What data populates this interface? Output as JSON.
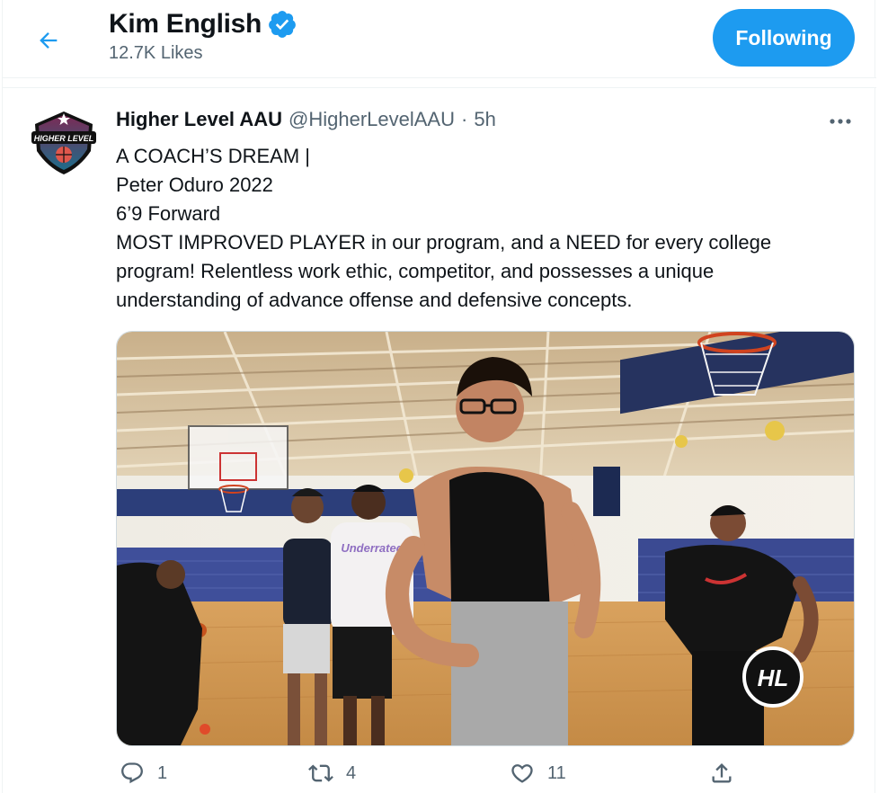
{
  "header": {
    "title": "Kim English",
    "subtitle": "12.7K Likes",
    "follow_label": "Following",
    "back_icon": "arrow-left-icon",
    "verified_icon": "verified-badge-icon"
  },
  "tweet": {
    "author_name": "Higher Level AAU",
    "handle": "@HigherLevelAAU",
    "separator": "·",
    "time": "5h",
    "avatar_text": "HIGHER LEVEL",
    "lines": [
      "A COACH’S DREAM |",
      "Peter Oduro 2022",
      "6’9 Forward",
      "MOST IMPROVED PLAYER in our program, and a NEED for every college",
      "program! Relentless work ethic, competitor, and possesses a unique",
      "understanding of advance offense and defensive concepts."
    ],
    "media": {
      "shirt_text": "Underrated",
      "watermark": "HL"
    },
    "actions": {
      "replies": "1",
      "retweets": "4",
      "likes": "11"
    }
  },
  "colors": {
    "accent": "#1d9bf0",
    "muted": "#536471",
    "text": "#0f1419"
  }
}
